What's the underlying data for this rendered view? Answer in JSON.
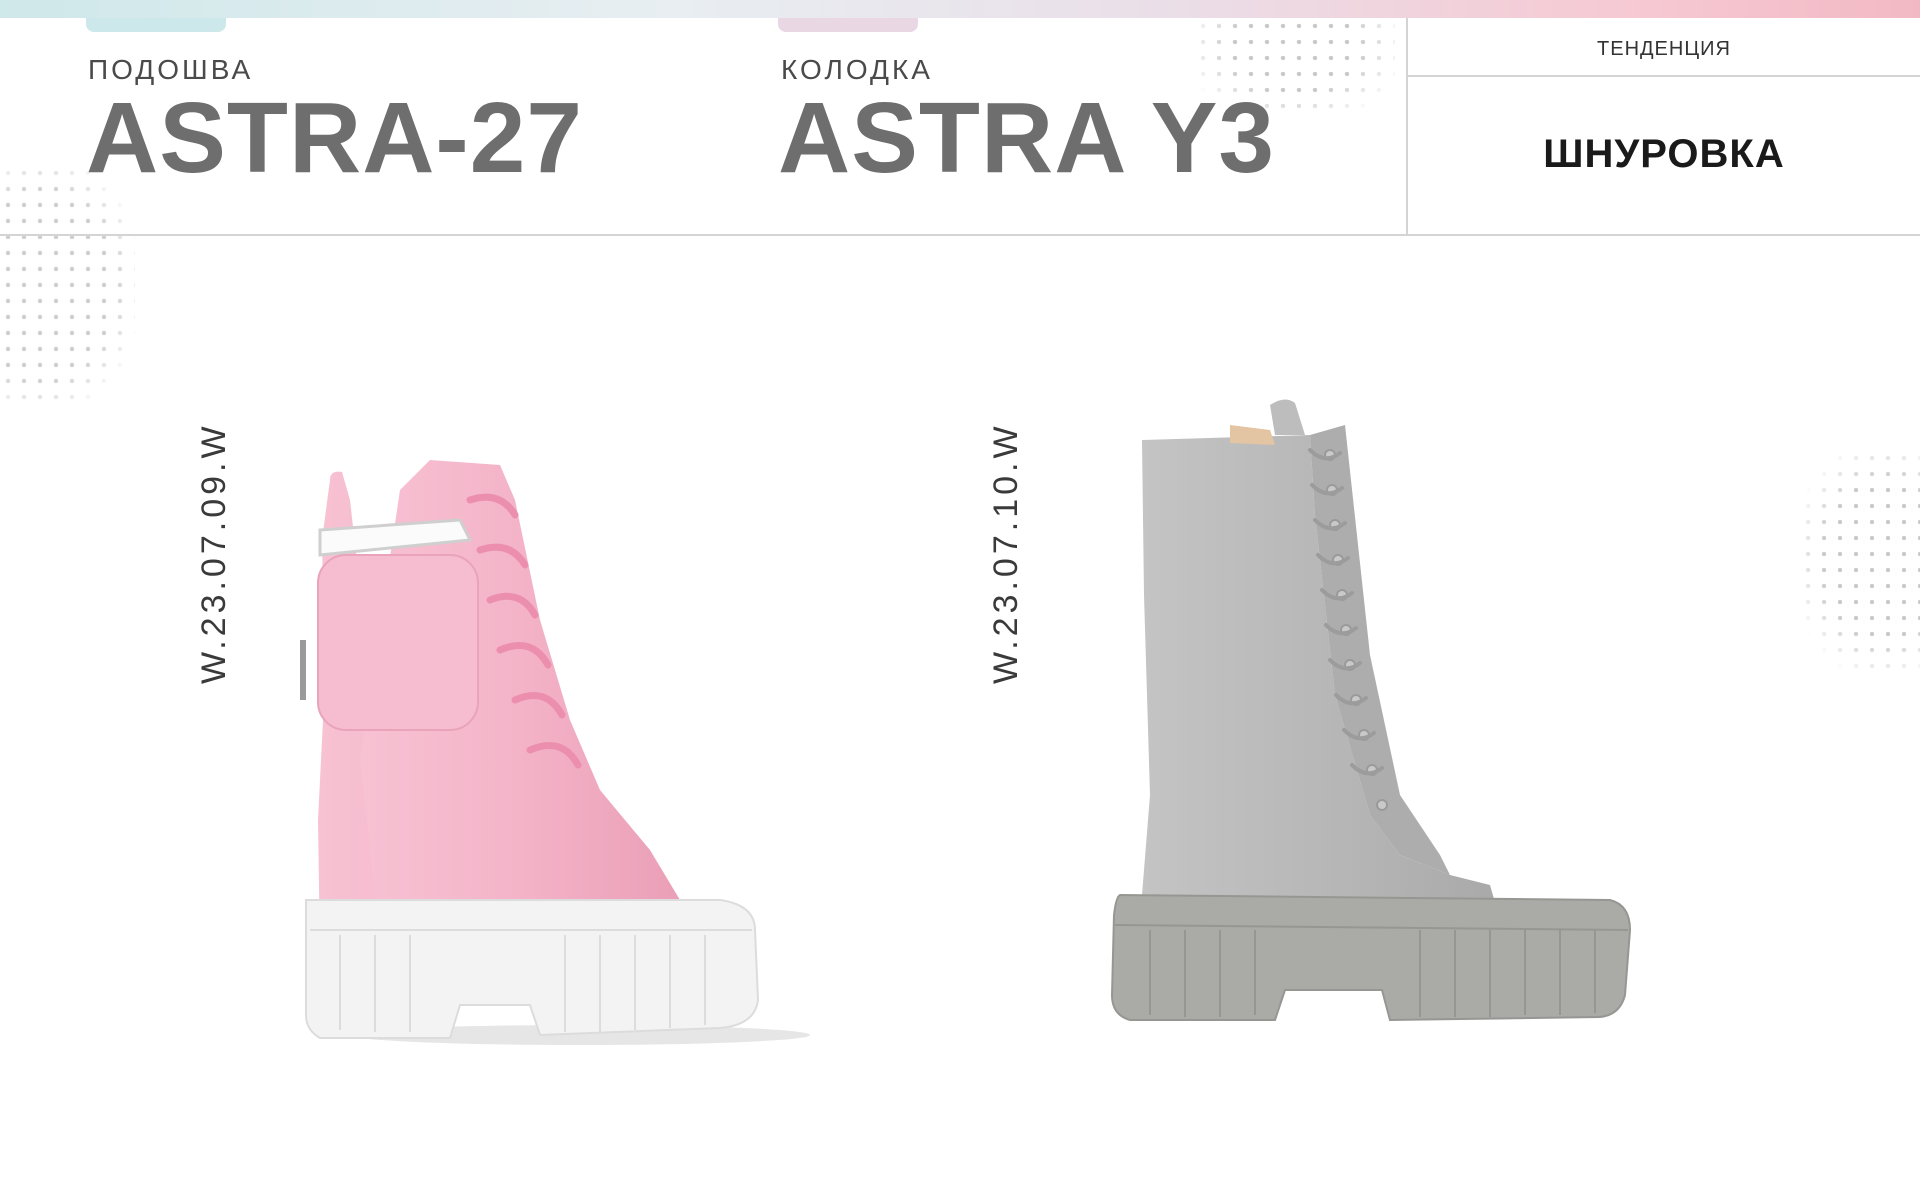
{
  "header": {
    "sole": {
      "label": "ПОДОШВА",
      "value": "ASTRA-27"
    },
    "last": {
      "label": "КОЛОДКА",
      "value": "ASTRA Y3"
    },
    "trend": {
      "label": "ТЕНДЕНЦИЯ",
      "value": "ШНУРОВКА"
    }
  },
  "products": [
    {
      "code": "W.23.07.09.W",
      "color": "#f4b3c8",
      "sole_color": "#f2f2f2",
      "icon": "pink-lace-up-boot-with-pouch"
    },
    {
      "code": "W.23.07.10.W",
      "color": "#b9b9b9",
      "sole_color": "#a8a8a5",
      "icon": "grey-suede-tall-lace-up-boot"
    }
  ],
  "colors": {
    "accent_text": "#6e6e6e",
    "divider": "#d4d4d4"
  }
}
